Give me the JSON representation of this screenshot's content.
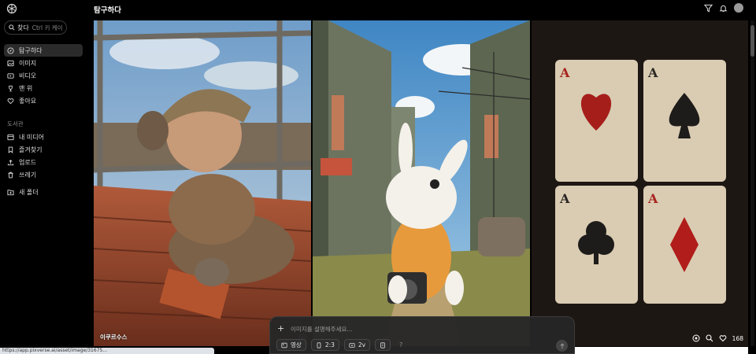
{
  "header": {
    "title": "탐구하다"
  },
  "search": {
    "label": "찾다",
    "shortcut": "Ctrl 키 케이"
  },
  "nav": [
    {
      "label": "탐구하다",
      "icon": "compass-icon",
      "active": true
    },
    {
      "label": "이미지",
      "icon": "image-icon"
    },
    {
      "label": "비디오",
      "icon": "video-icon"
    },
    {
      "label": "맨 위",
      "icon": "trophy-icon"
    },
    {
      "label": "좋아요",
      "icon": "heart-icon"
    }
  ],
  "library": {
    "title": "도서관",
    "items": [
      {
        "label": "내 미디어",
        "icon": "media-icon"
      },
      {
        "label": "즐겨찾기",
        "icon": "bookmark-icon"
      },
      {
        "label": "업로드",
        "icon": "upload-icon"
      },
      {
        "label": "쓰레기",
        "icon": "trash-icon"
      }
    ],
    "new_folder": "새 폴더"
  },
  "gallery": {
    "tile1_credit": "이쿠르수스",
    "tile3_likes": "168"
  },
  "prompt": {
    "placeholder": "이미지를 설명해주세요...",
    "chips": {
      "mode": "영상",
      "ratio": "2:3",
      "version": "2v"
    },
    "help": "?"
  },
  "status_url": "https://app.pixverse.ai/asset/image/31675..."
}
